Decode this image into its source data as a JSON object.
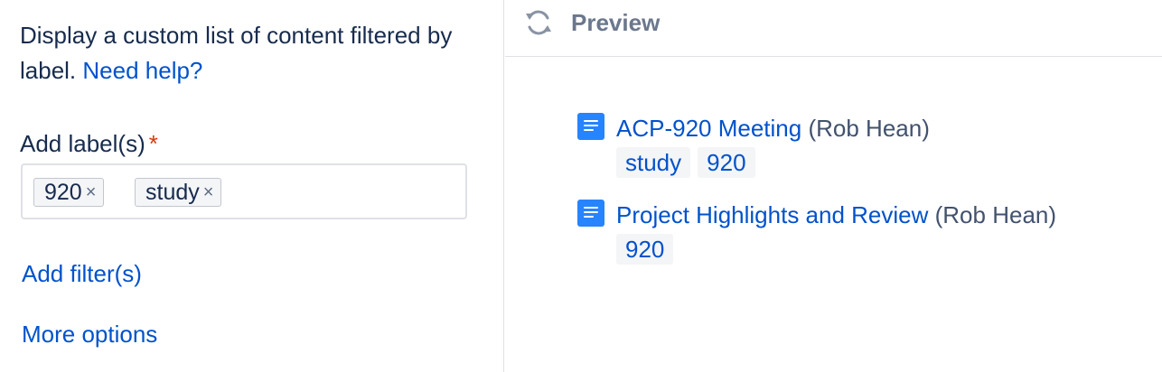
{
  "left_panel": {
    "description": "Display a custom list of content filtered by label.",
    "help_link": "Need help?",
    "field_label": "Add label(s)",
    "required_marker": "*",
    "chips": [
      {
        "label": "920",
        "remove": "×"
      },
      {
        "label": "study",
        "remove": "×"
      }
    ],
    "add_filters": "Add filter(s)",
    "more_options": "More options"
  },
  "preview": {
    "title": "Preview",
    "icon": "refresh-icon",
    "results": [
      {
        "title": "ACP-920 Meeting",
        "author": "(Rob Hean)",
        "labels": [
          "study",
          "920"
        ],
        "icon": "page-icon"
      },
      {
        "title": "Project Highlights and Review",
        "author": "(Rob Hean)",
        "labels": [
          "920"
        ],
        "icon": "page-icon"
      }
    ]
  },
  "colors": {
    "link": "#0052cc",
    "required": "#de350b",
    "page_icon": "#2684ff",
    "muted": "#6b778c"
  }
}
